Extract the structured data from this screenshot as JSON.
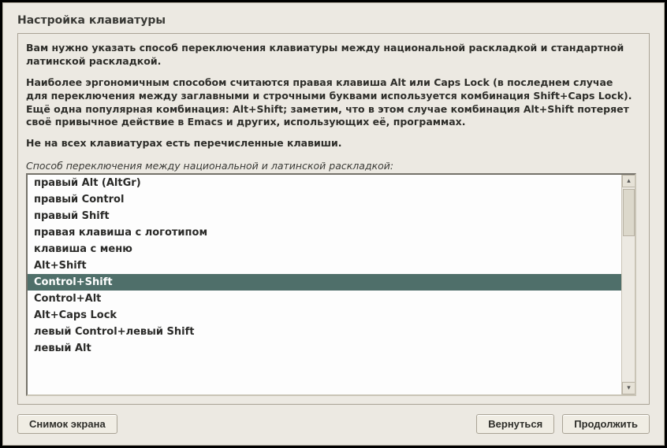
{
  "title": "Настройка клавиатуры",
  "info": {
    "p1": "Вам нужно указать способ переключения клавиатуры между национальной раскладкой и стандартной латинской раскладкой.",
    "p2": "Наиболее эргономичным способом считаются правая клавиша Alt или Caps Lock (в последнем случае для переключения между заглавными и строчными буквами используется комбинация Shift+Caps Lock). Ещё одна популярная комбинация: Alt+Shift; заметим, что в этом случае комбинация Alt+Shift потеряет своё привычное действие в Emacs и других, использующих её, программах.",
    "p3": "Не на всех клавиатурах есть перечисленные клавиши."
  },
  "list_label": "Способ переключения между национальной и латинской раскладкой:",
  "options": [
    "правый Alt (AltGr)",
    "правый Control",
    "правый Shift",
    "правая клавиша с логотипом",
    "клавиша с меню",
    "Alt+Shift",
    "Control+Shift",
    "Control+Alt",
    "Alt+Caps Lock",
    "левый Control+левый Shift",
    "левый Alt"
  ],
  "selected_index": 6,
  "buttons": {
    "screenshot": "Снимок экрана",
    "back": "Вернуться",
    "continue": "Продолжить"
  }
}
